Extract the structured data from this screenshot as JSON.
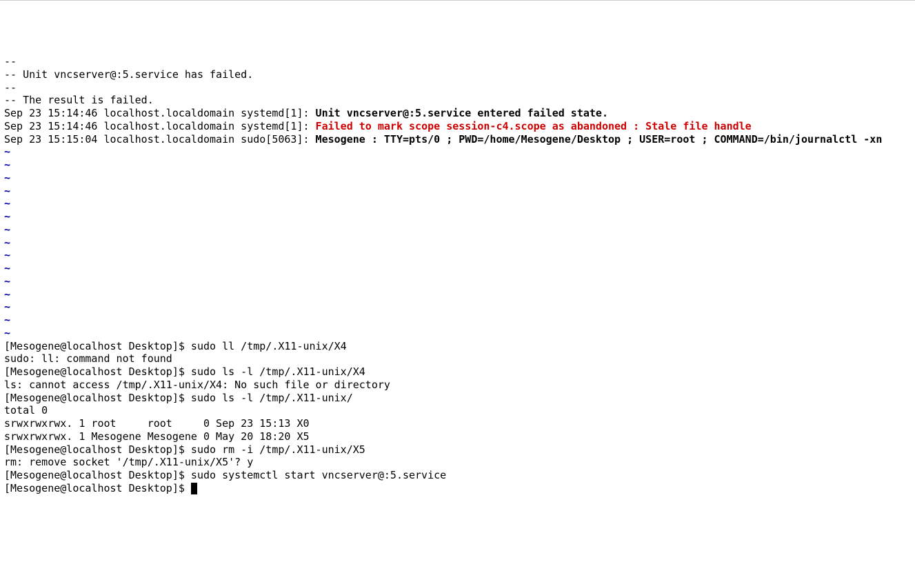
{
  "terminal": {
    "lines": [
      {
        "segments": [
          {
            "text": "--",
            "class": ""
          }
        ]
      },
      {
        "segments": [
          {
            "text": "-- Unit vncserver@:5.service has failed.",
            "class": ""
          }
        ]
      },
      {
        "segments": [
          {
            "text": "--",
            "class": ""
          }
        ]
      },
      {
        "segments": [
          {
            "text": "-- The result is failed.",
            "class": ""
          }
        ]
      },
      {
        "segments": [
          {
            "text": "Sep 23 15:14:46 localhost.localdomain systemd[1]: ",
            "class": ""
          },
          {
            "text": "Unit vncserver@:5.service entered failed state.",
            "class": "bold"
          }
        ]
      },
      {
        "segments": [
          {
            "text": "Sep 23 15:14:46 localhost.localdomain systemd[1]: ",
            "class": ""
          },
          {
            "text": "Failed to mark scope session-c4.scope as abandoned : Stale file handle",
            "class": "bold red"
          }
        ]
      },
      {
        "segments": [
          {
            "text": "Sep 23 15:15:04 localhost.localdomain sudo[5063]: ",
            "class": ""
          },
          {
            "text": "Mesogene : TTY=pts/0 ; PWD=/home/Mesogene/Desktop ; USER=root ; COMMAND=/bin/journalctl -xn",
            "class": "bold"
          }
        ]
      },
      {
        "segments": [
          {
            "text": "~",
            "class": "bold blue"
          }
        ]
      },
      {
        "segments": [
          {
            "text": "~",
            "class": "bold blue"
          }
        ]
      },
      {
        "segments": [
          {
            "text": "~",
            "class": "bold blue"
          }
        ]
      },
      {
        "segments": [
          {
            "text": "~",
            "class": "bold blue"
          }
        ]
      },
      {
        "segments": [
          {
            "text": "~",
            "class": "bold blue"
          }
        ]
      },
      {
        "segments": [
          {
            "text": "~",
            "class": "bold blue"
          }
        ]
      },
      {
        "segments": [
          {
            "text": "~",
            "class": "bold blue"
          }
        ]
      },
      {
        "segments": [
          {
            "text": "~",
            "class": "bold blue"
          }
        ]
      },
      {
        "segments": [
          {
            "text": "~",
            "class": "bold blue"
          }
        ]
      },
      {
        "segments": [
          {
            "text": "~",
            "class": "bold blue"
          }
        ]
      },
      {
        "segments": [
          {
            "text": "~",
            "class": "bold blue"
          }
        ]
      },
      {
        "segments": [
          {
            "text": "~",
            "class": "bold blue"
          }
        ]
      },
      {
        "segments": [
          {
            "text": "~",
            "class": "bold blue"
          }
        ]
      },
      {
        "segments": [
          {
            "text": "~",
            "class": "bold blue"
          }
        ]
      },
      {
        "segments": [
          {
            "text": "~",
            "class": "bold blue"
          }
        ]
      },
      {
        "segments": [
          {
            "text": "[Mesogene@localhost Desktop]$ sudo ll /tmp/.X11-unix/X4",
            "class": ""
          }
        ]
      },
      {
        "segments": [
          {
            "text": "sudo: ll: command not found",
            "class": ""
          }
        ]
      },
      {
        "segments": [
          {
            "text": "[Mesogene@localhost Desktop]$ sudo ls -l /tmp/.X11-unix/X4",
            "class": ""
          }
        ]
      },
      {
        "segments": [
          {
            "text": "ls: cannot access /tmp/.X11-unix/X4: No such file or directory",
            "class": ""
          }
        ]
      },
      {
        "segments": [
          {
            "text": "[Mesogene@localhost Desktop]$ sudo ls -l /tmp/.X11-unix/",
            "class": ""
          }
        ]
      },
      {
        "segments": [
          {
            "text": "total 0",
            "class": ""
          }
        ]
      },
      {
        "segments": [
          {
            "text": "srwxrwxrwx. 1 root     root     0 Sep 23 15:13 X0",
            "class": ""
          }
        ]
      },
      {
        "segments": [
          {
            "text": "srwxrwxrwx. 1 Mesogene Mesogene 0 May 20 18:20 X5",
            "class": ""
          }
        ]
      },
      {
        "segments": [
          {
            "text": "[Mesogene@localhost Desktop]$ sudo rm -i /tmp/.X11-unix/X5",
            "class": ""
          }
        ]
      },
      {
        "segments": [
          {
            "text": "rm: remove socket '/tmp/.X11-unix/X5'? y",
            "class": ""
          }
        ]
      },
      {
        "segments": [
          {
            "text": "[Mesogene@localhost Desktop]$ sudo systemctl start vncserver@:5.service",
            "class": ""
          }
        ]
      },
      {
        "segments": [
          {
            "text": "[Mesogene@localhost Desktop]$ ",
            "class": ""
          }
        ],
        "cursor": true
      }
    ]
  }
}
